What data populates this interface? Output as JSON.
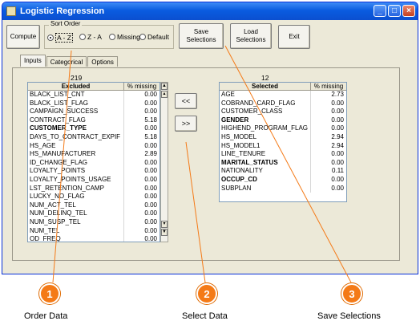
{
  "window": {
    "title": "Logistic Regression"
  },
  "toolbar": {
    "compute": "Compute",
    "save": "Save Selections",
    "load": "Load Selections",
    "exit": "Exit"
  },
  "sort_order": {
    "label": "Sort Order",
    "options": [
      "A - Z",
      "Z - A",
      "Missing",
      "Default"
    ],
    "selected": "A - Z"
  },
  "tabs": [
    "Inputs",
    "Categorical",
    "Options"
  ],
  "excluded": {
    "count": "219",
    "header": "Excluded",
    "pct_header": "% missing",
    "rows": [
      {
        "name": "BLACK_LIST_CNT",
        "pct": "0.00",
        "bold": false
      },
      {
        "name": "BLACK_LIST_FLAG",
        "pct": "0.00",
        "bold": false
      },
      {
        "name": "CAMPAIGN_SUCCESS",
        "pct": "0.00",
        "bold": false
      },
      {
        "name": "CONTRACT_FLAG",
        "pct": "5.18",
        "bold": false
      },
      {
        "name": "CUSTOMER_TYPE",
        "pct": "0.00",
        "bold": true
      },
      {
        "name": "DAYS_TO_CONTRACT_EXPIF",
        "pct": "5.18",
        "bold": false
      },
      {
        "name": "HS_AGE",
        "pct": "0.00",
        "bold": false
      },
      {
        "name": "HS_MANUFACTURER",
        "pct": "2.89",
        "bold": false
      },
      {
        "name": "ID_CHANGE_FLAG",
        "pct": "0.00",
        "bold": false
      },
      {
        "name": "LOYALTY_POINTS",
        "pct": "0.00",
        "bold": false
      },
      {
        "name": "LOYALTY_POINTS_USAGE",
        "pct": "0.00",
        "bold": false
      },
      {
        "name": "LST_RETENTION_CAMP",
        "pct": "0.00",
        "bold": false
      },
      {
        "name": "LUCKY_NO_FLAG",
        "pct": "0.00",
        "bold": false
      },
      {
        "name": "NUM_ACT_TEL",
        "pct": "0.00",
        "bold": false
      },
      {
        "name": "NUM_DELINQ_TEL",
        "pct": "0.00",
        "bold": false
      },
      {
        "name": "NUM_SUSP_TEL",
        "pct": "0.00",
        "bold": false
      },
      {
        "name": "NUM_TEL",
        "pct": "0.00",
        "bold": false
      },
      {
        "name": "OD_FREQ",
        "pct": "0.00",
        "bold": false
      }
    ]
  },
  "selected": {
    "count": "12",
    "header": "Selected",
    "pct_header": "% missing",
    "rows": [
      {
        "name": "AGE",
        "pct": "2.73",
        "bold": false
      },
      {
        "name": "COBRAND_CARD_FLAG",
        "pct": "0.00",
        "bold": false
      },
      {
        "name": "CUSTOMER_CLASS",
        "pct": "0.00",
        "bold": false
      },
      {
        "name": "GENDER",
        "pct": "0.00",
        "bold": true
      },
      {
        "name": "HIGHEND_PROGRAM_FLAG",
        "pct": "0.00",
        "bold": false
      },
      {
        "name": "HS_MODEL",
        "pct": "2.94",
        "bold": false
      },
      {
        "name": "HS_MODEL1",
        "pct": "2.94",
        "bold": false
      },
      {
        "name": "LINE_TENURE",
        "pct": "0.00",
        "bold": false
      },
      {
        "name": "MARITAL_STATUS",
        "pct": "0.00",
        "bold": true
      },
      {
        "name": "NATIONALITY",
        "pct": "0.11",
        "bold": false
      },
      {
        "name": "OCCUP_CD",
        "pct": "0.00",
        "bold": true
      },
      {
        "name": "SUBPLAN",
        "pct": "0.00",
        "bold": false
      }
    ]
  },
  "move": {
    "add": "<<",
    "remove": ">>"
  },
  "callouts": [
    {
      "num": "1",
      "label": "Order Data"
    },
    {
      "num": "2",
      "label": "Select Data"
    },
    {
      "num": "3",
      "label": "Save Selections"
    }
  ],
  "colors": {
    "callout": "#f47a17",
    "titlebar": "#0a5ce0"
  }
}
